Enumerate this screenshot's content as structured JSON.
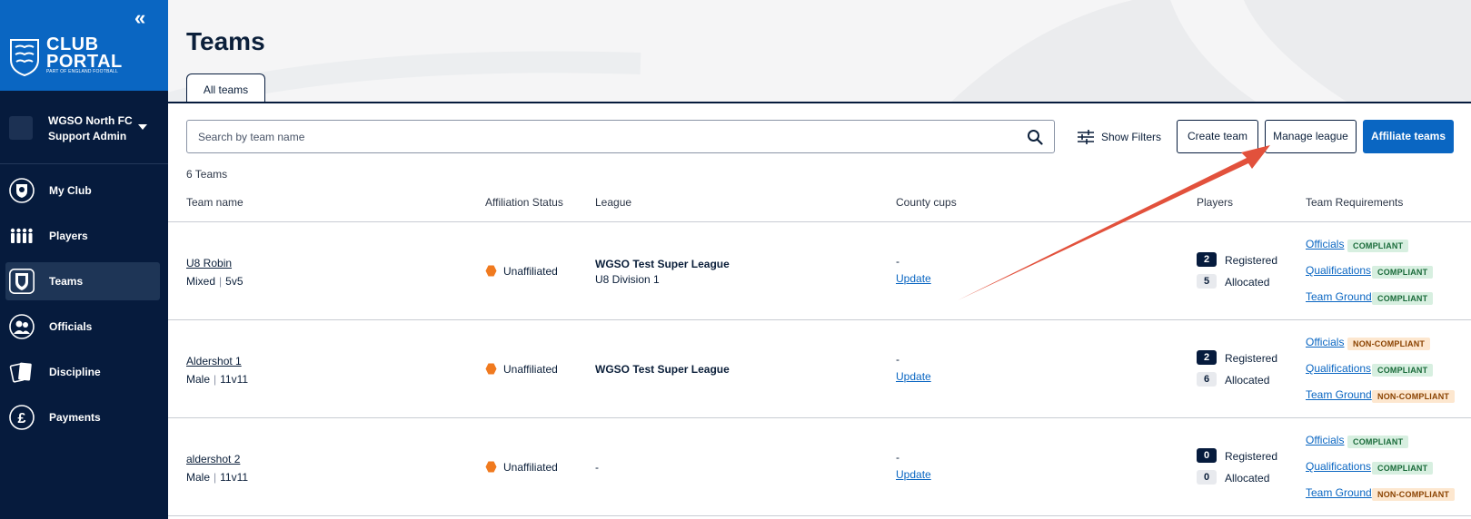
{
  "sidebar": {
    "brand_line1": "CLUB",
    "brand_line2": "PORTAL",
    "brand_sub": "PART OF ENGLAND FOOTBALL",
    "club_name": "WGSO North FC",
    "club_role": "Support Admin",
    "nav": [
      {
        "label": "My Club",
        "icon": "club-crest-icon"
      },
      {
        "label": "Players",
        "icon": "players-icon"
      },
      {
        "label": "Teams",
        "icon": "teams-shield-icon",
        "active": true
      },
      {
        "label": "Officials",
        "icon": "officials-icon"
      },
      {
        "label": "Discipline",
        "icon": "cards-icon"
      },
      {
        "label": "Payments",
        "icon": "pound-icon"
      }
    ]
  },
  "header": {
    "title": "Teams",
    "tab": "All teams"
  },
  "toolbar": {
    "search_placeholder": "Search by team name",
    "filters_label": "Show Filters",
    "create_label": "Create team",
    "manage_label": "Manage league",
    "affiliate_label": "Affiliate teams"
  },
  "table": {
    "count_text": "6 Teams",
    "columns": [
      "Team name",
      "Affiliation Status",
      "League",
      "County cups",
      "Players",
      "Team Requirements"
    ],
    "rows": [
      {
        "name": "U8 Robin",
        "gender": "Mixed",
        "format": "5v5",
        "status": "Unaffiliated",
        "league": "WGSO Test Super League",
        "division": "U8 Division 1",
        "cups_value": "-",
        "cups_action": "Update",
        "registered": "2",
        "registered_label": "Registered",
        "allocated": "5",
        "allocated_label": "Allocated",
        "requirements": [
          {
            "label": "Officials",
            "status": "COMPLIANT"
          },
          {
            "label": "Qualifications",
            "status": "COMPLIANT"
          },
          {
            "label": "Team Ground",
            "status": "COMPLIANT"
          }
        ]
      },
      {
        "name": "Aldershot 1",
        "gender": "Male",
        "format": "11v11",
        "status": "Unaffiliated",
        "league": "WGSO Test Super League",
        "division": "",
        "cups_value": "-",
        "cups_action": "Update",
        "registered": "2",
        "registered_label": "Registered",
        "allocated": "6",
        "allocated_label": "Allocated",
        "requirements": [
          {
            "label": "Officials",
            "status": "NON-COMPLIANT"
          },
          {
            "label": "Qualifications",
            "status": "COMPLIANT"
          },
          {
            "label": "Team Ground",
            "status": "NON-COMPLIANT"
          }
        ]
      },
      {
        "name": "aldershot 2",
        "gender": "Male",
        "format": "11v11",
        "status": "Unaffiliated",
        "league": "",
        "division": "-",
        "cups_value": "-",
        "cups_action": "Update",
        "registered": "0",
        "registered_label": "Registered",
        "allocated": "0",
        "allocated_label": "Allocated",
        "requirements": [
          {
            "label": "Officials",
            "status": "COMPLIANT"
          },
          {
            "label": "Qualifications",
            "status": "COMPLIANT"
          },
          {
            "label": "Team Ground",
            "status": "NON-COMPLIANT"
          }
        ]
      }
    ]
  },
  "colors": {
    "navy": "#061b3d",
    "brand_blue": "#0a66c2",
    "unaffiliated_orange": "#f07a1f",
    "annotation_red": "#e2513c"
  }
}
